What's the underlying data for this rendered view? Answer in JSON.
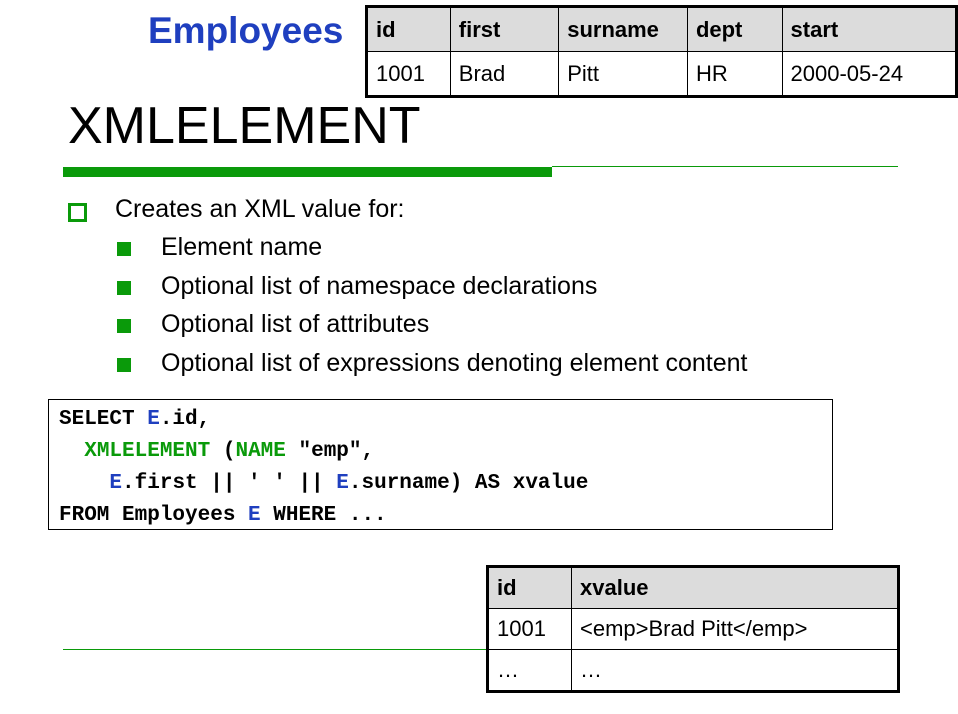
{
  "caption": "Employees",
  "employees_table": {
    "headers": [
      "id",
      "first",
      "surname",
      "dept",
      "start"
    ],
    "rows": [
      [
        "1001",
        "Brad",
        "Pitt",
        "HR",
        "2000-05-24"
      ]
    ]
  },
  "title": "XMLELEMENT",
  "bullets": {
    "main": "Creates an XML value for:",
    "sub": [
      "Element name",
      "Optional list of namespace declarations",
      "Optional list of attributes",
      "Optional list of expressions denoting element content"
    ]
  },
  "code": {
    "l1_a": "SELECT ",
    "l1_b": "E",
    "l1_c": ".id,",
    "l2_indent": "  ",
    "l2_a": "XMLELEMENT",
    "l2_b": " (",
    "l2_c": "NAME",
    "l2_d": " \"emp\",",
    "l3_indent": "    ",
    "l3_a": "E",
    "l3_b": ".first || ' ' || ",
    "l3_c": "E",
    "l3_d": ".surname) AS xvalue",
    "l4_a": "FROM Employees ",
    "l4_b": "E",
    "l4_c": " WHERE ..."
  },
  "result_table": {
    "headers": [
      "id",
      "xvalue"
    ],
    "rows": [
      [
        "1001",
        "<emp>Brad Pitt</emp>"
      ],
      [
        "…",
        "…"
      ]
    ]
  },
  "colors": {
    "accent_green": "#0a9a0a",
    "accent_blue": "#1f3fbf",
    "header_gray": "#dcdcdc"
  }
}
